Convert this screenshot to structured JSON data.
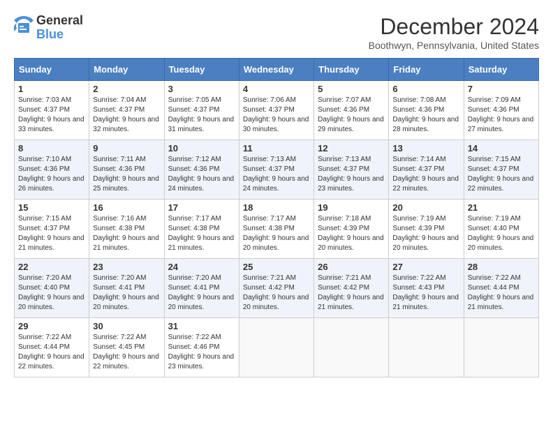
{
  "header": {
    "logo_general": "General",
    "logo_blue": "Blue",
    "month_title": "December 2024",
    "location": "Boothwyn, Pennsylvania, United States"
  },
  "weekdays": [
    "Sunday",
    "Monday",
    "Tuesday",
    "Wednesday",
    "Thursday",
    "Friday",
    "Saturday"
  ],
  "weeks": [
    [
      {
        "day": "1",
        "sunrise": "7:03 AM",
        "sunset": "4:37 PM",
        "daylight": "9 hours and 33 minutes."
      },
      {
        "day": "2",
        "sunrise": "7:04 AM",
        "sunset": "4:37 PM",
        "daylight": "9 hours and 32 minutes."
      },
      {
        "day": "3",
        "sunrise": "7:05 AM",
        "sunset": "4:37 PM",
        "daylight": "9 hours and 31 minutes."
      },
      {
        "day": "4",
        "sunrise": "7:06 AM",
        "sunset": "4:37 PM",
        "daylight": "9 hours and 30 minutes."
      },
      {
        "day": "5",
        "sunrise": "7:07 AM",
        "sunset": "4:36 PM",
        "daylight": "9 hours and 29 minutes."
      },
      {
        "day": "6",
        "sunrise": "7:08 AM",
        "sunset": "4:36 PM",
        "daylight": "9 hours and 28 minutes."
      },
      {
        "day": "7",
        "sunrise": "7:09 AM",
        "sunset": "4:36 PM",
        "daylight": "9 hours and 27 minutes."
      }
    ],
    [
      {
        "day": "8",
        "sunrise": "7:10 AM",
        "sunset": "4:36 PM",
        "daylight": "9 hours and 26 minutes."
      },
      {
        "day": "9",
        "sunrise": "7:11 AM",
        "sunset": "4:36 PM",
        "daylight": "9 hours and 25 minutes."
      },
      {
        "day": "10",
        "sunrise": "7:12 AM",
        "sunset": "4:36 PM",
        "daylight": "9 hours and 24 minutes."
      },
      {
        "day": "11",
        "sunrise": "7:13 AM",
        "sunset": "4:37 PM",
        "daylight": "9 hours and 24 minutes."
      },
      {
        "day": "12",
        "sunrise": "7:13 AM",
        "sunset": "4:37 PM",
        "daylight": "9 hours and 23 minutes."
      },
      {
        "day": "13",
        "sunrise": "7:14 AM",
        "sunset": "4:37 PM",
        "daylight": "9 hours and 22 minutes."
      },
      {
        "day": "14",
        "sunrise": "7:15 AM",
        "sunset": "4:37 PM",
        "daylight": "9 hours and 22 minutes."
      }
    ],
    [
      {
        "day": "15",
        "sunrise": "7:15 AM",
        "sunset": "4:37 PM",
        "daylight": "9 hours and 21 minutes."
      },
      {
        "day": "16",
        "sunrise": "7:16 AM",
        "sunset": "4:38 PM",
        "daylight": "9 hours and 21 minutes."
      },
      {
        "day": "17",
        "sunrise": "7:17 AM",
        "sunset": "4:38 PM",
        "daylight": "9 hours and 21 minutes."
      },
      {
        "day": "18",
        "sunrise": "7:17 AM",
        "sunset": "4:38 PM",
        "daylight": "9 hours and 20 minutes."
      },
      {
        "day": "19",
        "sunrise": "7:18 AM",
        "sunset": "4:39 PM",
        "daylight": "9 hours and 20 minutes."
      },
      {
        "day": "20",
        "sunrise": "7:19 AM",
        "sunset": "4:39 PM",
        "daylight": "9 hours and 20 minutes."
      },
      {
        "day": "21",
        "sunrise": "7:19 AM",
        "sunset": "4:40 PM",
        "daylight": "9 hours and 20 minutes."
      }
    ],
    [
      {
        "day": "22",
        "sunrise": "7:20 AM",
        "sunset": "4:40 PM",
        "daylight": "9 hours and 20 minutes."
      },
      {
        "day": "23",
        "sunrise": "7:20 AM",
        "sunset": "4:41 PM",
        "daylight": "9 hours and 20 minutes."
      },
      {
        "day": "24",
        "sunrise": "7:20 AM",
        "sunset": "4:41 PM",
        "daylight": "9 hours and 20 minutes."
      },
      {
        "day": "25",
        "sunrise": "7:21 AM",
        "sunset": "4:42 PM",
        "daylight": "9 hours and 20 minutes."
      },
      {
        "day": "26",
        "sunrise": "7:21 AM",
        "sunset": "4:42 PM",
        "daylight": "9 hours and 21 minutes."
      },
      {
        "day": "27",
        "sunrise": "7:22 AM",
        "sunset": "4:43 PM",
        "daylight": "9 hours and 21 minutes."
      },
      {
        "day": "28",
        "sunrise": "7:22 AM",
        "sunset": "4:44 PM",
        "daylight": "9 hours and 21 minutes."
      }
    ],
    [
      {
        "day": "29",
        "sunrise": "7:22 AM",
        "sunset": "4:44 PM",
        "daylight": "9 hours and 22 minutes."
      },
      {
        "day": "30",
        "sunrise": "7:22 AM",
        "sunset": "4:45 PM",
        "daylight": "9 hours and 22 minutes."
      },
      {
        "day": "31",
        "sunrise": "7:22 AM",
        "sunset": "4:46 PM",
        "daylight": "9 hours and 23 minutes."
      },
      null,
      null,
      null,
      null
    ]
  ]
}
